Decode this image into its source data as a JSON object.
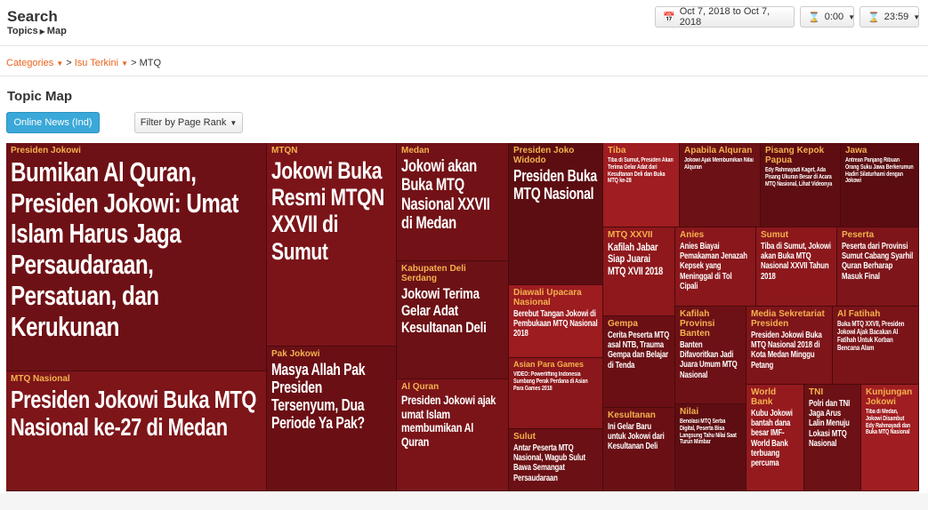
{
  "header": {
    "title": "Search",
    "breadcrumb": [
      "Topics",
      "Map"
    ],
    "date_range": "Oct 7, 2018 to Oct 7, 2018",
    "time_start": "0:00",
    "time_end": "23:59"
  },
  "nav": {
    "categories": "Categories",
    "isu": "Isu Terkini",
    "current": "MTQ"
  },
  "section": {
    "title": "Topic Map",
    "source_button": "Online News (Ind)",
    "filter_button": "Filter by Page Rank"
  },
  "colors": {
    "accent": "#e8631c",
    "button_blue": "#3aa8d8",
    "category_text": "#f4b24e"
  },
  "chart_data": {
    "type": "treemap",
    "cells": [
      {
        "category": "Presiden Jokowi",
        "title": "Bumikan Al Quran, Presiden Jokowi: Umat Islam Harus Jaga Persaudaraan, Persatuan, dan Kerukunan",
        "color": "#6e1116"
      },
      {
        "category": "MTQ Nasional",
        "title": "Presiden Jokowi Buka MTQ Nasional ke-27 di Medan",
        "color": "#7d1519"
      },
      {
        "category": "MTQN",
        "title": "Jokowi Buka Resmi MTQN XXVII di Sumut",
        "color": "#7b1419"
      },
      {
        "category": "Pak Jokowi",
        "title": "Masya Allah Pak Presiden Tersenyum, Dua Periode Ya Pak?",
        "color": "#6a1015"
      },
      {
        "category": "Medan",
        "title": "Jokowi akan Buka MTQ Nasional XXVII di Medan",
        "color": "#721217"
      },
      {
        "category": "Kabupaten Deli Serdang",
        "title": "Jokowi Terima Gelar Adat Kesultanan Deli",
        "color": "#6c1115"
      },
      {
        "category": "Al Quran",
        "title": "Presiden Jokowi ajak umat Islam membumikan Al Quran",
        "color": "#7a1419"
      },
      {
        "category": "Presiden Joko Widodo",
        "title": "Presiden Buka MTQ Nasional",
        "color": "#5c0d11"
      },
      {
        "category": "Diawali Upacara Nasional",
        "title": "Berebut Tangan Jokowi di Pembukaan MTQ Nasional 2018",
        "color": "#9c1c20"
      },
      {
        "category": "Asian Para Games",
        "title": "VIDEO: Powerlifting Indonesia Sumbang Perak Perdana di Asian Para Games 2018",
        "color": "#8a171b"
      },
      {
        "category": "Sulut",
        "title": "Antar Peserta MTQ Nasional, Wagub Sulut Bawa Semangat Persaudaraan",
        "color": "#6b1014"
      },
      {
        "category": "Tiba",
        "title": "Tiba di Sumut, Presiden Akan Terima Gelar Adat dari Kesultanan Deli dan Buka MTQ ke-28",
        "color": "#a01d21"
      },
      {
        "category": "Apabila Alquran",
        "title": "Jokowi Ajak Membumikan Nilai Alquran",
        "color": "#6c1115"
      },
      {
        "category": "Pisang Kepok Papua",
        "title": "Edy Rahmayadi Kaget, Ada Pisang Ukuran Besar di Acara MTQ Nasional, Lihat Videonya",
        "color": "#5e0e12"
      },
      {
        "category": "Jawa",
        "title": "Antrean Panjang Ribuan Orang Suku Jawa Berkerumun Hadiri Silaturhami dengan Jokowi",
        "color": "#5a0c10"
      },
      {
        "category": "MTQ XXVII",
        "title": "Kafilah Jabar Siap Juarai MTQ XVII 2018",
        "color": "#8e181c"
      },
      {
        "category": "Anies",
        "title": "Anies Biayai Pemakaman Jenazah Kepsek yang Meninggal di Tol Cipali",
        "color": "#8a171b"
      },
      {
        "category": "Sumut",
        "title": "Tiba di Sumut, Jokowi akan Buka MTQ Nasional XXVII Tahun 2018",
        "color": "#8c181c"
      },
      {
        "category": "Peserta",
        "title": "Peserta dari Provinsi Sumut Cabang Syarhil Quran Berharap Masuk Final",
        "color": "#7e151a"
      },
      {
        "category": "Gempa",
        "title": "Cerita Peserta MTQ asal NTB, Trauma Gempa dan Belajar di Tenda",
        "color": "#6a1014"
      },
      {
        "category": "Kafilah Provinsi Banten",
        "title": "Banten Difavoritkan Jadi Juara Umum MTQ Nasional",
        "color": "#6e1116"
      },
      {
        "category": "Media Sekretariat Presiden",
        "title": "Presiden Jokowi Buka MTQ Nasional 2018 di Kota Medan Minggu Petang",
        "color": "#7e151a"
      },
      {
        "category": "Al Fatihah",
        "title": "Buka MTQ XXVII, Presiden Jokowi Ajak Bacakan Al Fatihah Untuk Korban Bencana Alam",
        "color": "#7b1419"
      },
      {
        "category": "Kesultanan",
        "title": "Ini Gelar Baru untuk Jokowi dari Kesultanan Deli",
        "color": "#6a1014"
      },
      {
        "category": "Nilai",
        "title": "Benolasi MTQ Serba Digital, Peserta Bisa Langsung Tahu Nilai Saat Turun Mimbar",
        "color": "#5e0e12"
      },
      {
        "category": "World Bank",
        "title": "Kubu Jokowi bantah dana besar IMF-World Bank terbuang percuma",
        "color": "#951a1e"
      },
      {
        "category": "TNI",
        "title": "Polri dan TNI Jaga Arus Lalin Menuju Lokasi MTQ Nasional",
        "color": "#6c1115"
      },
      {
        "category": "Kunjungan Jokowi",
        "title": "Tiba di Medan, Jokowi Disambut Edy Rahmayadi dan Buka MTQ Nasional",
        "color": "#a01d21"
      }
    ]
  }
}
